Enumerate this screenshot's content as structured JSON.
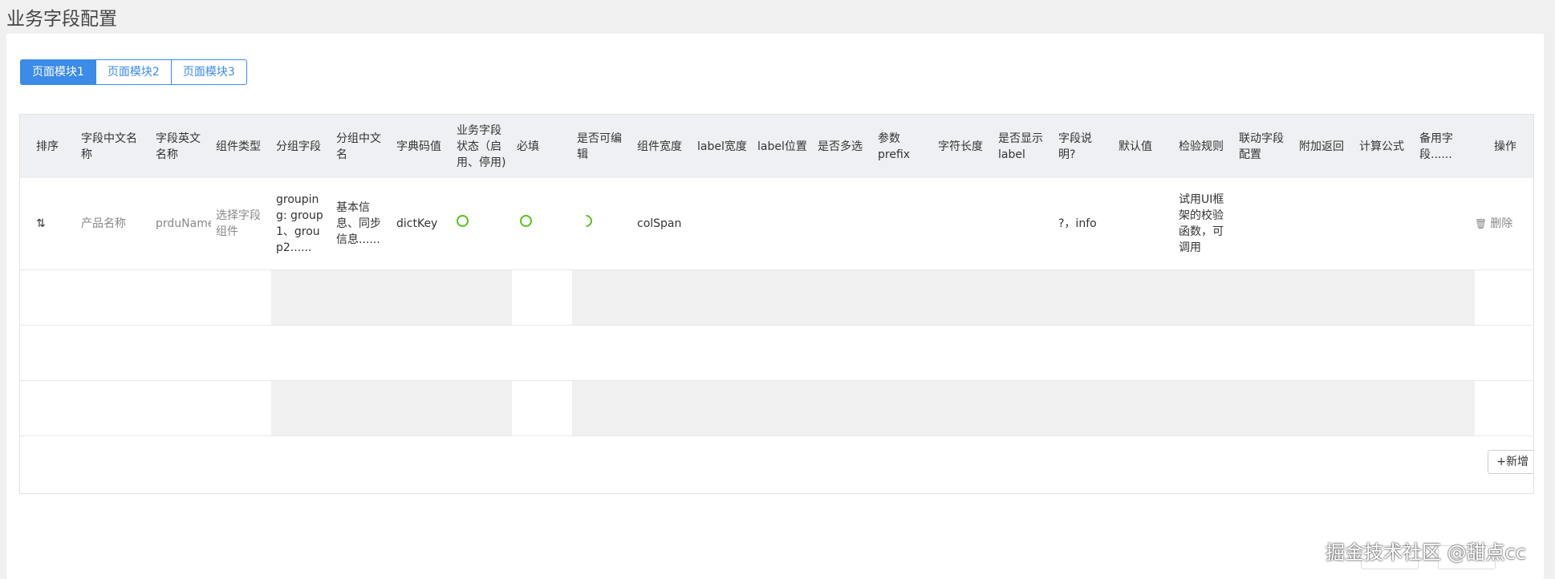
{
  "page": {
    "title": "业务字段配置"
  },
  "tabs": [
    {
      "label": "页面模块1",
      "active": true
    },
    {
      "label": "页面模块2",
      "active": false
    },
    {
      "label": "页面模块3",
      "active": false
    }
  ],
  "table": {
    "headers": [
      "排序",
      "字段中文名称",
      "字段英文名称",
      "组件类型",
      "分组字段",
      "分组中文名",
      "字典码值",
      "业务字段状态（启用、停用)",
      "必填",
      "是否可编辑",
      "组件宽度",
      "label宽度",
      "label位置",
      "是否多选",
      "参数prefix",
      "字符长度",
      "是否显示label",
      "字段说明?",
      "默认值",
      "检验规则",
      "联动字段配置",
      "附加返回",
      "计算公式",
      "备用字段......",
      "操作"
    ],
    "row": {
      "sort_icon": "⇅",
      "cn_name": "产品名称",
      "en_name": "prduName",
      "component_type": "选择字段组件",
      "group_field": "grouping: group1、group2......",
      "group_cn": "基本信息、同步信息......",
      "dict_key": "dictKey",
      "width": "colSpan",
      "field_desc": "?，info",
      "validation": "试用UI框架的校验函数，可调用",
      "delete_label": "删除",
      "delete_icon": "trash-icon"
    },
    "add_label": "+新增"
  },
  "watermark": "掘金技术社区 @甜点cc",
  "colors": {
    "primary": "#3b8be8",
    "success": "#52c41a"
  }
}
